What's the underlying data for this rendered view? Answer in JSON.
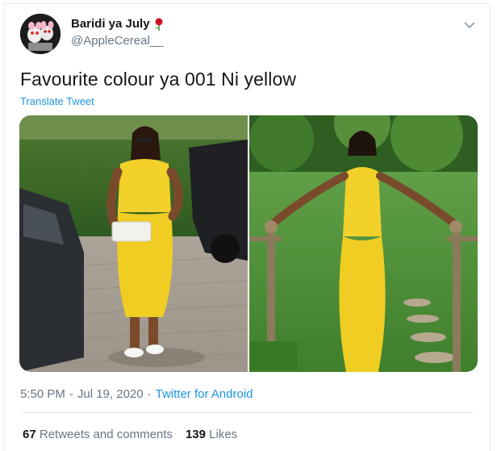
{
  "tweet": {
    "display_name": "Baridi ya July",
    "handle": "@AppleCereal__",
    "text": "Favourite colour ya 001 Ni yellow",
    "translate_label": "Translate Tweet",
    "time": "5:50 PM",
    "separator": "·",
    "date": "Jul 19, 2020",
    "source": "Twitter for Android",
    "retweets_count": "67",
    "retweets_label": "Retweets and comments",
    "likes_count": "139",
    "likes_label": "Likes"
  },
  "colors": {
    "link": "#1b95e0",
    "secondary_text": "#657786",
    "primary_text": "#14171a",
    "dress_yellow": "#f2d12a"
  },
  "icons": {
    "name_emoji": "rose-icon",
    "menu": "chevron-down-icon"
  }
}
